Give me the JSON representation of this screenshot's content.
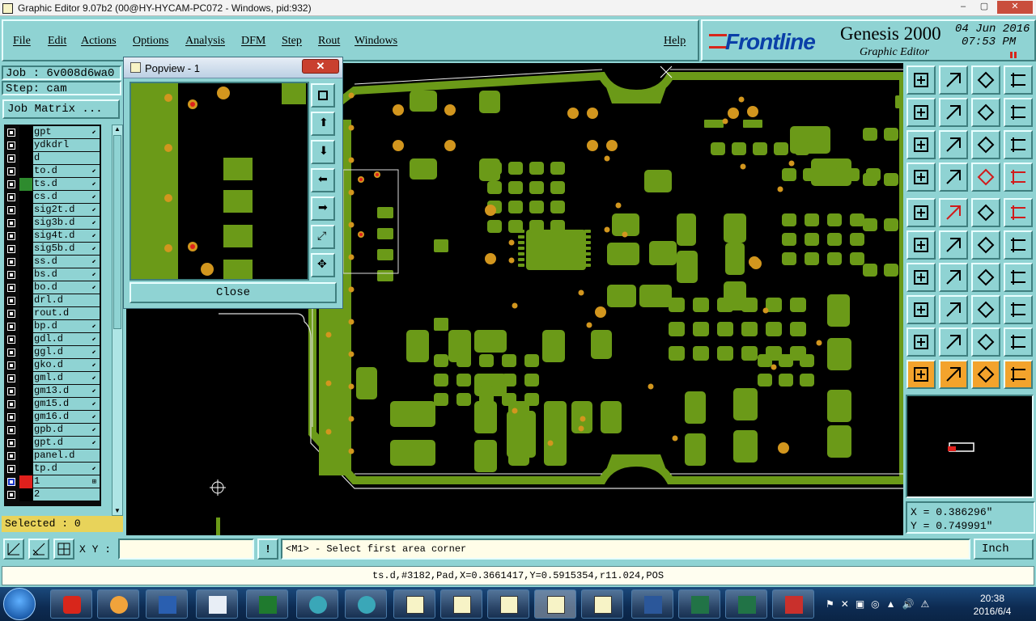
{
  "window": {
    "title": "Graphic Editor 9.07b2 (00@HY-HYCAM-PC072 - Windows, pid:932)"
  },
  "menu": [
    "File",
    "Edit",
    "Actions",
    "Options",
    "Analysis",
    "DFM",
    "Step",
    "Rout",
    "Windows",
    "Help"
  ],
  "brand": {
    "logo": "Frontline",
    "product": "Genesis 2000",
    "subtitle": "Graphic Editor",
    "date": "04 Jun 2016",
    "time": "07:53 PM"
  },
  "job": {
    "job_label": "Job : 6v008d6wa0",
    "step_label": "Step: cam",
    "matrix_button": "Job Matrix ..."
  },
  "layers": [
    {
      "name": "gpt",
      "flag": "⬋"
    },
    {
      "name": "ydkdrl",
      "flag": ""
    },
    {
      "name": "d",
      "flag": ""
    },
    {
      "name": "to.d",
      "flag": "⬋"
    },
    {
      "name": "ts.d",
      "flag": "⬋",
      "swatch": "#2e8b2e"
    },
    {
      "name": "cs.d",
      "flag": "⬋"
    },
    {
      "name": "sig2t.d",
      "flag": "⬋"
    },
    {
      "name": "sig3b.d",
      "flag": "⬋"
    },
    {
      "name": "sig4t.d",
      "flag": "⬋"
    },
    {
      "name": "sig5b.d",
      "flag": "⬋"
    },
    {
      "name": "ss.d",
      "flag": "⬋"
    },
    {
      "name": "bs.d",
      "flag": "⬋"
    },
    {
      "name": "bo.d",
      "flag": "⬋"
    },
    {
      "name": "drl.d",
      "flag": ""
    },
    {
      "name": "rout.d",
      "flag": ""
    },
    {
      "name": "bp.d",
      "flag": "⬋"
    },
    {
      "name": "gdl.d",
      "flag": "⬋"
    },
    {
      "name": "ggl.d",
      "flag": "⬋"
    },
    {
      "name": "gko.d",
      "flag": "⬋"
    },
    {
      "name": "gml.d",
      "flag": "⬋"
    },
    {
      "name": "gm13.d",
      "flag": "⬋"
    },
    {
      "name": "gm15.d",
      "flag": "⬋"
    },
    {
      "name": "gm16.d",
      "flag": "⬋"
    },
    {
      "name": "gpb.d",
      "flag": "⬋"
    },
    {
      "name": "gpt.d",
      "flag": "⬋"
    },
    {
      "name": "panel.d",
      "flag": ""
    },
    {
      "name": "tp.d",
      "flag": "⬋"
    },
    {
      "name": "1",
      "flag": "⊞",
      "swatch": "#e0201c",
      "active": true
    },
    {
      "name": "2",
      "flag": ""
    }
  ],
  "selected": "Selected : 0",
  "popview": {
    "title": "Popview - 1",
    "close_label": "Close",
    "close_x": "✕"
  },
  "coords": {
    "x": "X = 0.386296\"",
    "y": "Y = 0.749991\""
  },
  "bottom": {
    "xy_label": "X Y :",
    "xy_value": "",
    "message": "<M1> - Select first area corner",
    "unit": "Inch",
    "alert": "!"
  },
  "status": "ts.d,#3182,Pad,X=0.3661417,Y=0.5915354,r11.024,POS",
  "clock": {
    "time": "20:38",
    "date": "2016/6/4"
  },
  "colors": {
    "pad": "#6b9a18",
    "drill": "#d2961e",
    "board": "#000000",
    "panel": "#8fd3d3",
    "accent": "#f3a32c"
  }
}
